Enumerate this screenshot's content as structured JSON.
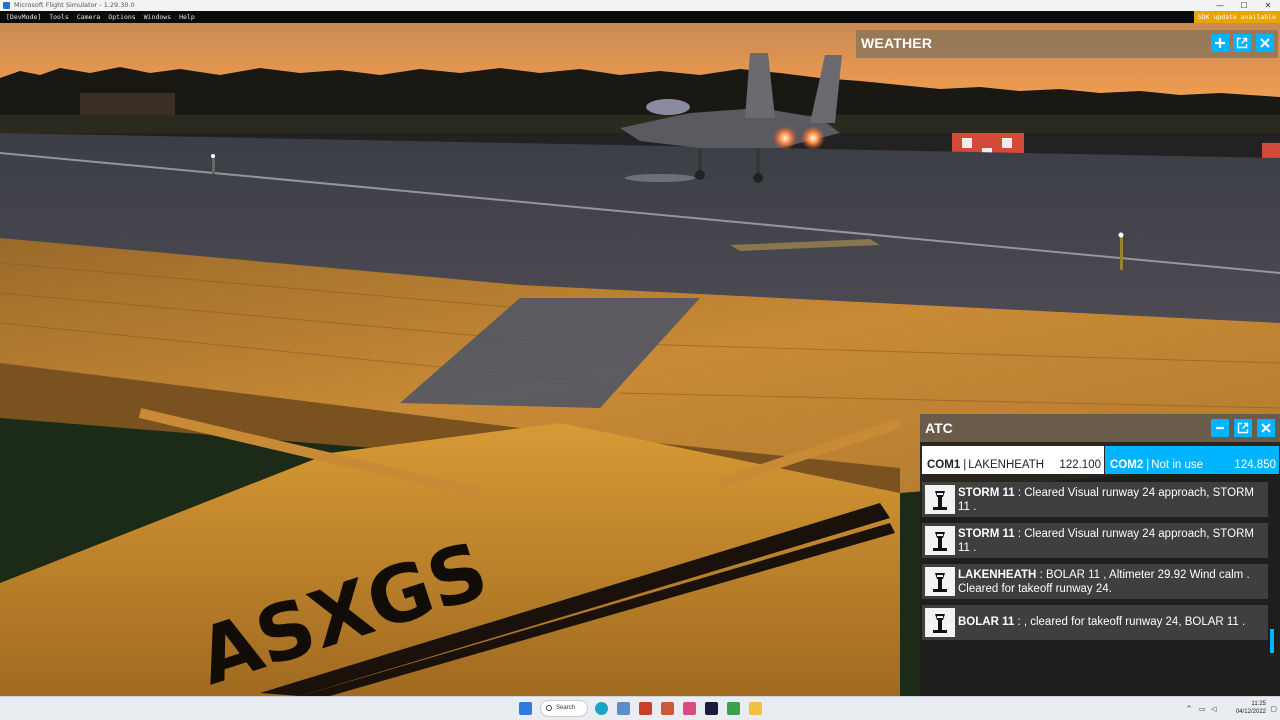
{
  "window": {
    "title": "Microsoft Flight Simulator - 1.29.30.0",
    "minimize": "—",
    "maximize": "☐",
    "close": "✕"
  },
  "devmenu": {
    "items": [
      "[DevMode]",
      "Tools",
      "Camera",
      "Options",
      "Windows",
      "Help"
    ],
    "sdk_notice": "SDK update available",
    "sdk_color": "#e9a400"
  },
  "scene": {
    "aircraft_registration": "ASXGS"
  },
  "weather_panel": {
    "title": "WEATHER",
    "buttons": [
      "plus-icon",
      "popout-icon",
      "close-icon"
    ]
  },
  "atc_panel": {
    "title": "ATC",
    "accent_color": "#00b4ff",
    "com1": {
      "label": "COM1",
      "station": "LAKENHEATH",
      "frequency": "122.100"
    },
    "com2": {
      "label": "COM2",
      "station": "Not in use",
      "frequency": "124.850"
    },
    "messages": [
      {
        "speaker": "STORM 11",
        "text": " : Cleared Visual runway 24 approach, STORM 11 ."
      },
      {
        "speaker": "STORM 11",
        "text": " : Cleared Visual runway 24 approach, STORM 11 ."
      },
      {
        "speaker": "LAKENHEATH",
        "text": " : BOLAR 11 , Altimeter 29.92 Wind calm . Cleared for takeoff runway 24."
      },
      {
        "speaker": "BOLAR 11",
        "text": " : , cleared for takeoff runway 24, BOLAR 11 ."
      }
    ]
  },
  "taskbar": {
    "search_label": "Search",
    "time": "11:25",
    "date": "04/12/2022"
  }
}
